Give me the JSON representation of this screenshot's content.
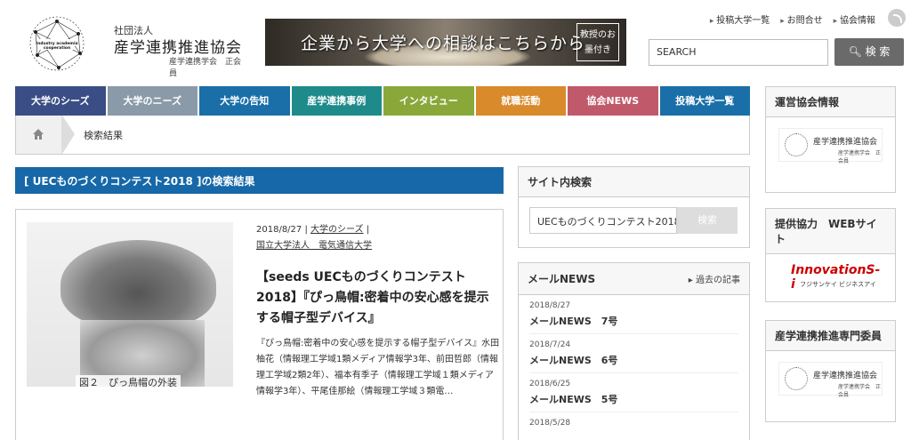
{
  "header": {
    "logo_top": "社団法人",
    "logo_main": "産学連携推進協会",
    "logo_sub": "産学連携学会　正会員",
    "logo_mark_text": "Industry academia cooperation",
    "banner_text": "企業から大学への相談はこちらから",
    "banner_badge": "教授のお墨付き",
    "top_links": [
      "投稿大学一覧",
      "お問合せ",
      "協会情報"
    ],
    "search_placeholder": "SEARCH",
    "search_button": "検 索"
  },
  "nav": [
    {
      "label": "大学のシーズ",
      "color": "#3a4e85"
    },
    {
      "label": "大学のニーズ",
      "color": "#8a9aa8"
    },
    {
      "label": "大学の告知",
      "color": "#1a6fa8"
    },
    {
      "label": "産学連携事例",
      "color": "#1e8a8a"
    },
    {
      "label": "インタビュー",
      "color": "#8aa83a"
    },
    {
      "label": "就職活動",
      "color": "#d98a2a"
    },
    {
      "label": "協会NEWS",
      "color": "#c05a6a"
    },
    {
      "label": "投稿大学一覧",
      "color": "#1a6fa8"
    }
  ],
  "breadcrumb": {
    "current": "検索結果"
  },
  "results": {
    "heading": "[ UECものづくりコンテスト2018 ]の検索結果",
    "item": {
      "date": "2018/8/27",
      "category": "大学のシーズ",
      "university": "国立大学法人　電気通信大学",
      "title": "【seeds UECものづくりコンテスト2018】『ぴっ鳥帽:密着中の安心感を提示する帽子型デバイス』",
      "excerpt": "『ぴっ鳥帽:密着中の安心感を提示する帽子型デバイス』水田柚花（情報理工学域1類メディア情報学3年、前田哲郎（情報理工学域2類2年）、福本有季子（情報理工学域１類メディア情報学3年）、平尾佳那絵（情報理工学域３類電…",
      "image_caption": "図２　ぴっ鳥帽の外装"
    }
  },
  "site_search": {
    "title": "サイト内検索",
    "value": "UECものづくりコンテスト2018",
    "button": "検索"
  },
  "mail_news": {
    "title": "メールNEWS",
    "past_link": "過去の記事",
    "items": [
      {
        "date": "2018/8/27",
        "title": "メールNEWS　7号"
      },
      {
        "date": "2018/7/24",
        "title": "メールNEWS　6号"
      },
      {
        "date": "2018/6/25",
        "title": "メールNEWS　5号"
      },
      {
        "date": "2018/5/28",
        "title": ""
      }
    ]
  },
  "right": {
    "box1_title": "運営協会情報",
    "box2_title": "提供協力　WEBサイト",
    "box3_title": "産学連携推進専門委員",
    "mini_logo_top": "社団法人",
    "mini_logo_main": "産学連携推進協会",
    "mini_logo_sub": "産学連携学会　正会員",
    "innov_main": "InnovationS-i",
    "innov_sub": "フジサンケイ ビジネスアイ"
  }
}
